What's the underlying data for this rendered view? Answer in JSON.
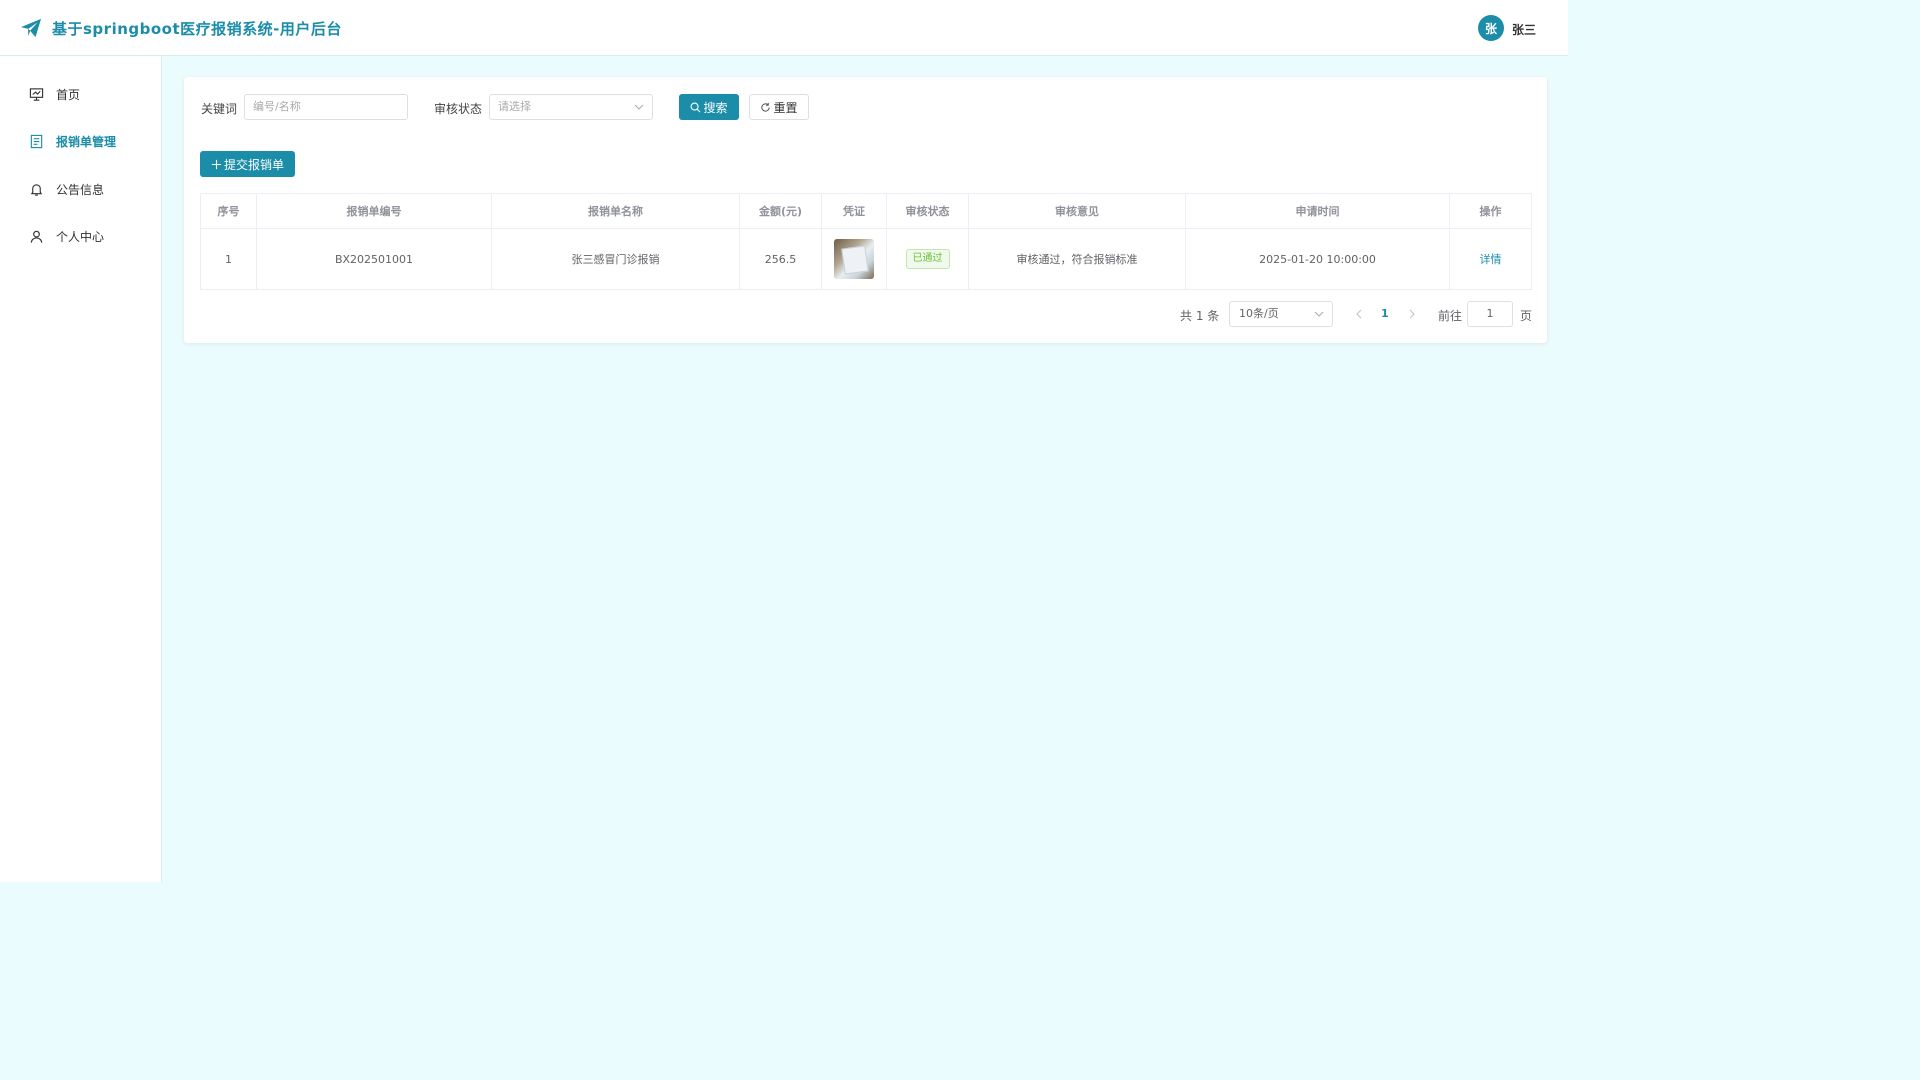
{
  "header": {
    "title": "基于springboot医疗报销系统-用户后台",
    "avatar_text": "张",
    "username": "张三",
    "brand_color": "#1b8da8"
  },
  "sidebar": {
    "items": [
      {
        "label": "首页",
        "icon": "presentation-icon",
        "active": false
      },
      {
        "label": "报销单管理",
        "icon": "document-icon",
        "active": true
      },
      {
        "label": "公告信息",
        "icon": "bell-icon",
        "active": false
      },
      {
        "label": "个人中心",
        "icon": "user-icon",
        "active": false
      }
    ]
  },
  "filters": {
    "keyword_label": "关键词",
    "keyword_placeholder": "编号/名称",
    "status_label": "审核状态",
    "status_placeholder": "请选择",
    "search_label": "搜索",
    "reset_label": "重置"
  },
  "actions": {
    "submit_label": "提交报销单"
  },
  "table": {
    "columns": [
      "序号",
      "报销单编号",
      "报销单名称",
      "金额(元)",
      "凭证",
      "审核状态",
      "审核意见",
      "申请时间",
      "操作"
    ],
    "rows": [
      {
        "index": "1",
        "code": "BX202501001",
        "name": "张三感冒门诊报销",
        "amount": "256.5",
        "voucher": "receipt-thumbnail",
        "status": "已通过",
        "opinion": "审核通过，符合报销标准",
        "time": "2025-01-20 10:00:00",
        "action": "详情"
      }
    ]
  },
  "pagination": {
    "total_text": "共 1 条",
    "page_size": "10条/页",
    "current_page": "1",
    "goto_label": "前往",
    "goto_value": "1",
    "page_suffix": "页"
  }
}
